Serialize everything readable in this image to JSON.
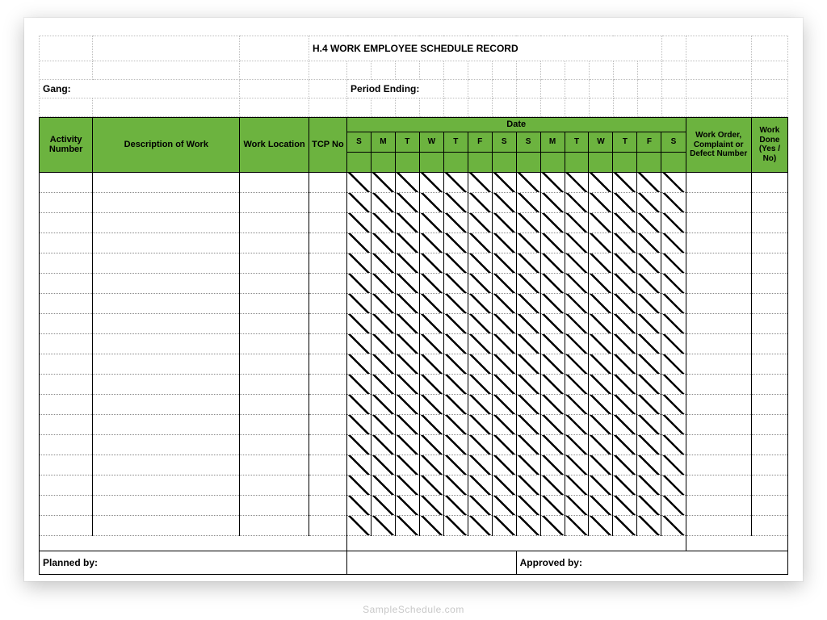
{
  "title": "H.4    WORK  EMPLOYEE SCHEDULE  RECORD",
  "fields": {
    "gang_label": "Gang:",
    "period_label": "Period Ending:",
    "planned_label": "Planned by:",
    "approved_label": "Approved by:"
  },
  "headers": {
    "activity": "Activity Number",
    "description": "Description of Work",
    "location": "Work Location",
    "tcp": "TCP No",
    "date": "Date",
    "work_order": "Work Order, Complaint or Defect Number",
    "done": "Work Done (Yes / No)"
  },
  "days": [
    "S",
    "M",
    "T",
    "W",
    "T",
    "F",
    "S",
    "S",
    "M",
    "T",
    "W",
    "T",
    "F",
    "S"
  ],
  "body_rows": 18,
  "watermark": "SampleSchedule.com"
}
